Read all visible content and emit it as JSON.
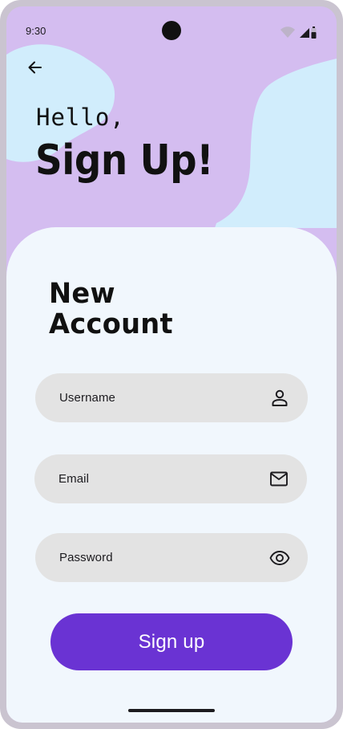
{
  "status_bar": {
    "time": "9:30"
  },
  "header": {
    "back_icon": "arrow-back-icon",
    "greeting": "Hello,",
    "title": "Sign Up!"
  },
  "form": {
    "title_line1": "New",
    "title_line2": "Account",
    "fields": [
      {
        "label": "Username",
        "icon": "person-icon"
      },
      {
        "label": "Email",
        "icon": "mail-icon"
      },
      {
        "label": "Password",
        "icon": "eye-icon"
      }
    ],
    "submit_label": "Sign up"
  },
  "colors": {
    "background_purple": "#d4bdf0",
    "blob_blue": "#d1edfc",
    "card": "#f1f7fd",
    "field": "#e3e3e3",
    "button": "#6a33d3",
    "frame": "#cac4d0"
  }
}
